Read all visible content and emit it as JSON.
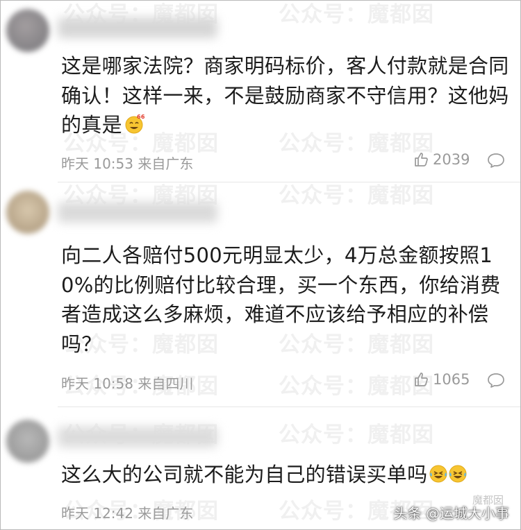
{
  "watermark_text": "公众号：魔都囡",
  "comments": [
    {
      "text": "这是哪家法院？商家明码标价，客人付款就是合同确认！这样一来，不是鼓励商家不守信用？这他妈的真是",
      "emoji": "grinning-666-emoji",
      "time": "昨天 10:53 来自广东",
      "likes": "2039",
      "avatar_color": "#8f8a8c"
    },
    {
      "text": "向二人各赔付500元明显太少，4万总金额按照10%的比例赔付比较合理，买一个东西，你给消费者造成这么多麻烦，难道不应该给予相应的补偿吗？",
      "time": "昨天 10:58 来自四川",
      "likes": "1065",
      "avatar_color": "#c3b39a"
    },
    {
      "text": "这么大的公司就不能为自己的错误买单吗",
      "emoji": "laughing-tears-emoji",
      "time": "昨天 12:42 来自广东",
      "avatar_color": "#a9a9a9"
    }
  ],
  "credit": "头条 @运城大小事",
  "footer_watermark": "魔都囡"
}
